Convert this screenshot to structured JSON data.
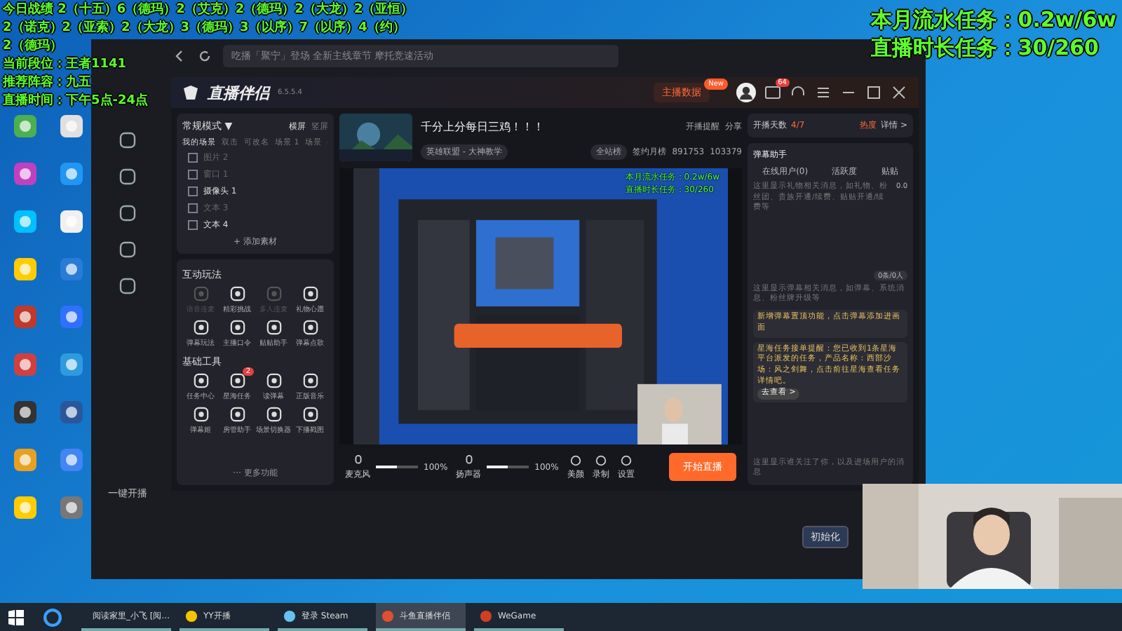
{
  "overlay_left": {
    "lines": [
      "今日战绩 2（十五）6（德玛）2（艾克）2（德玛）2（大龙）2（亚恒）",
      "2（诺克）2（亚索）2（大龙）3（德玛）3（以序）7（以序）4（约）",
      "2（德玛）",
      "当前段位：王者1141",
      "推荐阵容：九五",
      "直播时间：下午5点-24点"
    ]
  },
  "overlay_right": {
    "lines": [
      "本月流水任务：0.2w/6w",
      "直播时长任务：30/260"
    ]
  },
  "browser": {
    "search_placeholder": "吃播「聚宁」登场 全新主线章节 摩托竞速活动",
    "rail_label": "一键开播"
  },
  "app": {
    "title": "直播伴侣",
    "version": "6.5.5.4",
    "data_button": "主播数据",
    "new_badge": "New",
    "message_count": "64",
    "mode": "常规模式 ▼",
    "orientations": [
      {
        "label": "横屏",
        "selected": true
      },
      {
        "label": "竖屏",
        "selected": false
      }
    ],
    "scene_tabs": [
      {
        "label": "我的场景",
        "selected": true
      },
      {
        "label": "双击",
        "selected": false
      },
      {
        "label": "可改名",
        "selected": false
      },
      {
        "label": "场景 1",
        "selected": false
      },
      {
        "label": "场景",
        "selected": false
      }
    ],
    "sources": [
      {
        "label": "图片 2",
        "visible": false
      },
      {
        "label": "窗口 1",
        "visible": false
      },
      {
        "label": "摄像头 1",
        "visible": true
      },
      {
        "label": "文本 3",
        "visible": false
      },
      {
        "label": "文本 4",
        "visible": true
      }
    ],
    "add_source": "+ 添加素材",
    "sections": [
      {
        "title": "互动玩法",
        "tools": [
          {
            "label": "语音连麦",
            "disabled": true
          },
          {
            "label": "精彩挑战",
            "disabled": false
          },
          {
            "label": "多人连麦",
            "disabled": true
          },
          {
            "label": "礼物心愿",
            "disabled": false
          },
          {
            "label": "弹幕玩法",
            "disabled": false
          },
          {
            "label": "主播口令",
            "disabled": false
          },
          {
            "label": "贴贴助手",
            "disabled": false
          },
          {
            "label": "弹幕点歌",
            "disabled": false
          }
        ]
      },
      {
        "title": "基础工具",
        "tools": [
          {
            "label": "任务中心",
            "disabled": false
          },
          {
            "label": "星海任务",
            "disabled": false,
            "badge": "2"
          },
          {
            "label": "读弹幕",
            "disabled": false
          },
          {
            "label": "正版音乐",
            "disabled": false
          },
          {
            "label": "弹幕姬",
            "disabled": false
          },
          {
            "label": "房管助手",
            "disabled": false
          },
          {
            "label": "场景切换器",
            "disabled": false
          },
          {
            "label": "下播戳图",
            "disabled": false
          }
        ]
      }
    ],
    "more": "··· 更多功能",
    "stream_title": "千分上分每日三鸡！！！",
    "category": "英雄联盟 - 大神教学",
    "remind": "开播提醒",
    "share": "分享",
    "rank": "全站榜",
    "monthly": "签约月榜",
    "stat_1": "891753",
    "stat_2": "103379",
    "preview_lines": [
      "本月流水任务：0.2w/6w",
      "直播时长任务：30/260"
    ],
    "controls": [
      {
        "kind": "slider",
        "label": "麦克风",
        "level": 0.5,
        "reading": "100%"
      },
      {
        "kind": "slider",
        "label": "扬声器",
        "level": 0.5,
        "reading": "100%"
      },
      {
        "kind": "button",
        "label": "美颜"
      },
      {
        "kind": "button",
        "label": "录制"
      },
      {
        "kind": "button",
        "label": "设置"
      }
    ],
    "start_button": "开始直播",
    "days_label": "开播天数",
    "days_value": "4/7",
    "heat": "热度",
    "details": "详情 >",
    "assistant": "弹幕助手",
    "assistant_tabs": [
      {
        "label": "在线用户(0)",
        "selected": false
      },
      {
        "label": "活跃度",
        "selected": false
      },
      {
        "label": "贴贴",
        "selected": false
      }
    ],
    "gift_hint": "这里显示礼物相关消息，如礼物、粉丝团、贵族开通/续费、贴贴开通/续费等",
    "gift_value": "0.0",
    "chat_hint": "这里显示弹幕相关消息，如弹幕、系统消息、粉丝牌升级等",
    "chat_count": "0条/0人",
    "notices": [
      "新增弹幕置顶功能，点击弹幕添加进画面",
      "星海任务接单提醒：您已收到1条星海平台派发的任务，产品名称：西部沙场：风之剑舞，点击前往星海查看任务详情吧。"
    ],
    "notice_link": "去查看 >",
    "follow_hint": "这里显示谁关注了你，以及进场用户的消息"
  },
  "init_button": "初始化",
  "taskbar": [
    {
      "label": "阅读家里_小飞 [阅...",
      "selected": false
    },
    {
      "label": "YY开播",
      "selected": false
    },
    {
      "label": "登录 Steam",
      "selected": false
    },
    {
      "label": "斗鱼直播伴侣",
      "selected": true
    },
    {
      "label": "WeGame",
      "selected": false
    }
  ]
}
